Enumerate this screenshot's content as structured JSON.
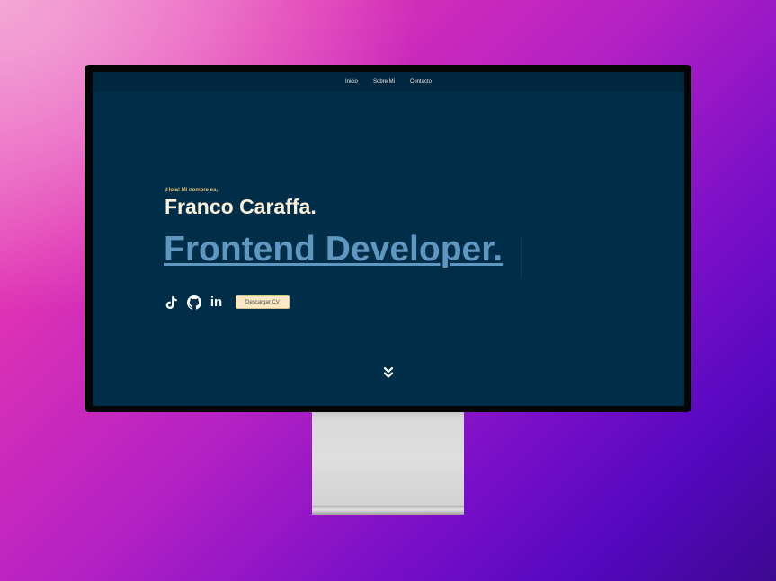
{
  "nav": {
    "items": [
      "Inicio",
      "Sobre Mi",
      "Contacto"
    ]
  },
  "hero": {
    "greeting": "¡Hola! Mi nombre es,",
    "name": "Franco Caraffa.",
    "role": "Frontend Developer."
  },
  "socials": [
    {
      "icon": "tiktok-icon"
    },
    {
      "icon": "github-icon"
    },
    {
      "icon": "linkedin-icon",
      "text": "in"
    }
  ],
  "actions": {
    "cv_label": "Descargar CV",
    "scroll_icon": "double-chevron-down-icon"
  },
  "colors": {
    "screen_bg": "#002d47",
    "nav_bg": "#01273f",
    "greeting": "#f0cd7a",
    "name": "#fbf1da",
    "role": "#5e97bf",
    "cv_button_bg": "#fbe9c6"
  }
}
